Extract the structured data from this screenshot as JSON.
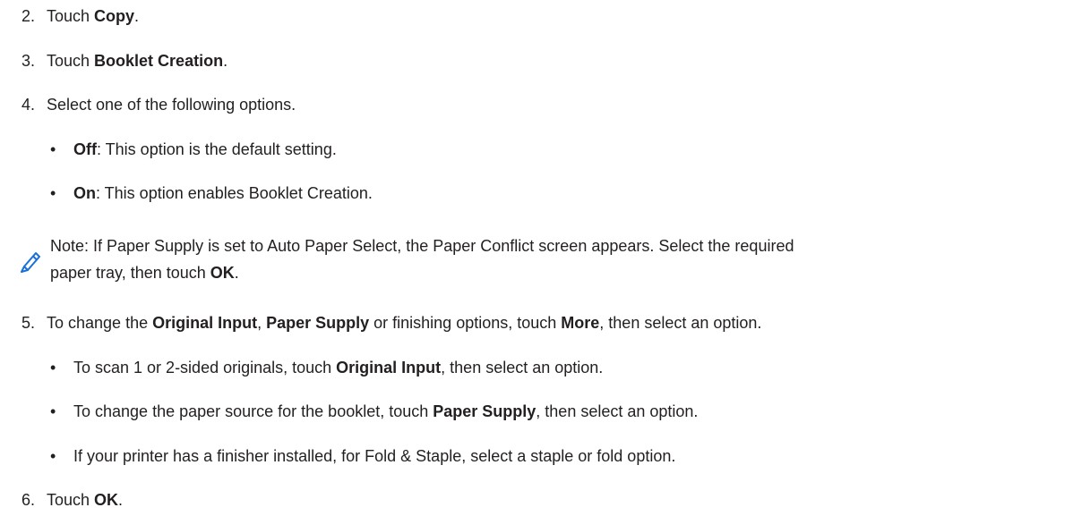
{
  "steps": [
    {
      "num": "2.",
      "pre": "Touch ",
      "bold": "Copy",
      "post": "."
    },
    {
      "num": "3.",
      "pre": "Touch ",
      "bold": "Booklet Creation",
      "post": "."
    },
    {
      "num": "4.",
      "text": "Select one of the following options."
    },
    {
      "num": "5.",
      "pre": "To change the ",
      "bold1": "Original Input",
      "mid1": ", ",
      "bold2": "Paper Supply",
      "mid2": " or finishing options, touch ",
      "bold3": "More",
      "post": ", then select an option."
    },
    {
      "num": "6.",
      "pre": "Touch ",
      "bold": "OK",
      "post": "."
    }
  ],
  "step4_options": [
    {
      "bold": "Off",
      "text": ": This option is the default setting."
    },
    {
      "bold": "On",
      "text": ": This option enables Booklet Creation."
    }
  ],
  "note": {
    "icon": "pencil-icon",
    "line1": "Note: If Paper Supply is set to Auto Paper Select, the Paper Conflict screen appears. Select the required",
    "line2_pre": "paper tray, then touch ",
    "line2_bold": "OK",
    "line2_post": "."
  },
  "step5_options": [
    {
      "pre": "To scan 1 or 2-sided originals, touch ",
      "bold": "Original Input",
      "post": ", then select an option."
    },
    {
      "pre": "To change the paper source for the booklet, touch ",
      "bold": "Paper Supply",
      "post": ", then select an option."
    },
    {
      "text": "If your printer has a finisher installed, for Fold & Staple, select a staple or fold option."
    }
  ],
  "colors": {
    "text": "#231f20",
    "icon": "#1a6fd8"
  }
}
